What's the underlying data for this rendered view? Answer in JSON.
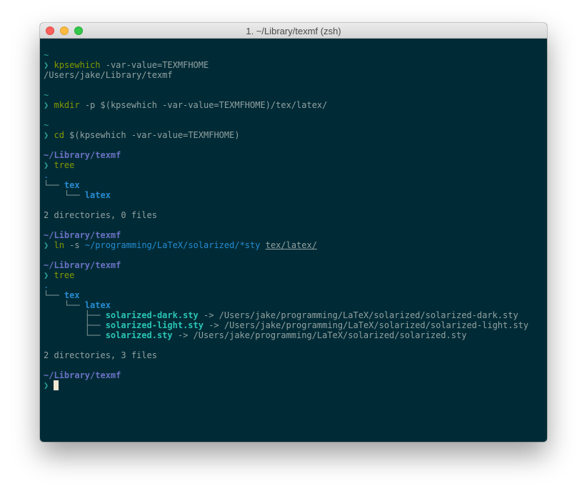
{
  "window": {
    "title": "1. ~/Library/texmf (zsh)"
  },
  "prompt": {
    "symbol": "❯",
    "home": "~",
    "dir": "~/Library/texmf"
  },
  "commands": {
    "c1": {
      "cmd": "kpsewhich",
      "args": "-var-value=TEXMFHOME"
    },
    "c1_output": "/Users/jake/Library/texmf",
    "c2": {
      "cmd": "mkdir",
      "args": "-p $(kpsewhich -var-value=TEXMFHOME)/tex/latex/"
    },
    "c3": {
      "cmd": "cd",
      "args": "$(kpsewhich -var-value=TEXMFHOME)"
    },
    "c4": {
      "cmd": "tree"
    },
    "c5": {
      "cmd": "ln",
      "flag": "-s",
      "src": "~/programming/LaTeX/solarized/*sty",
      "dst": "tex/latex/"
    },
    "c6": {
      "cmd": "tree"
    }
  },
  "tree1": {
    "root": ".",
    "branch_tex": "└── ",
    "tex": "tex",
    "branch_latex": "    └── ",
    "latex": "latex",
    "summary": "2 directories, 0 files"
  },
  "tree2": {
    "root": ".",
    "branch_tex": "└── ",
    "tex": "tex",
    "branch_latex": "    └── ",
    "latex": "latex",
    "files": [
      {
        "branch": "        ├── ",
        "name": "solarized-dark.sty",
        "target": " -> /Users/jake/programming/LaTeX/solarized/solarized-dark.sty"
      },
      {
        "branch": "        ├── ",
        "name": "solarized-light.sty",
        "target": " -> /Users/jake/programming/LaTeX/solarized/solarized-light.sty"
      },
      {
        "branch": "        └── ",
        "name": "solarized.sty",
        "target": " -> /Users/jake/programming/LaTeX/solarized/solarized.sty"
      }
    ],
    "summary": "2 directories, 3 files"
  },
  "colors": {
    "background": "#002b36",
    "prompt_path": "#6c71c4",
    "prompt_symbol": "#2aa198",
    "command": "#859900",
    "directory": "#268bd2",
    "symlink": "#2aa198"
  }
}
